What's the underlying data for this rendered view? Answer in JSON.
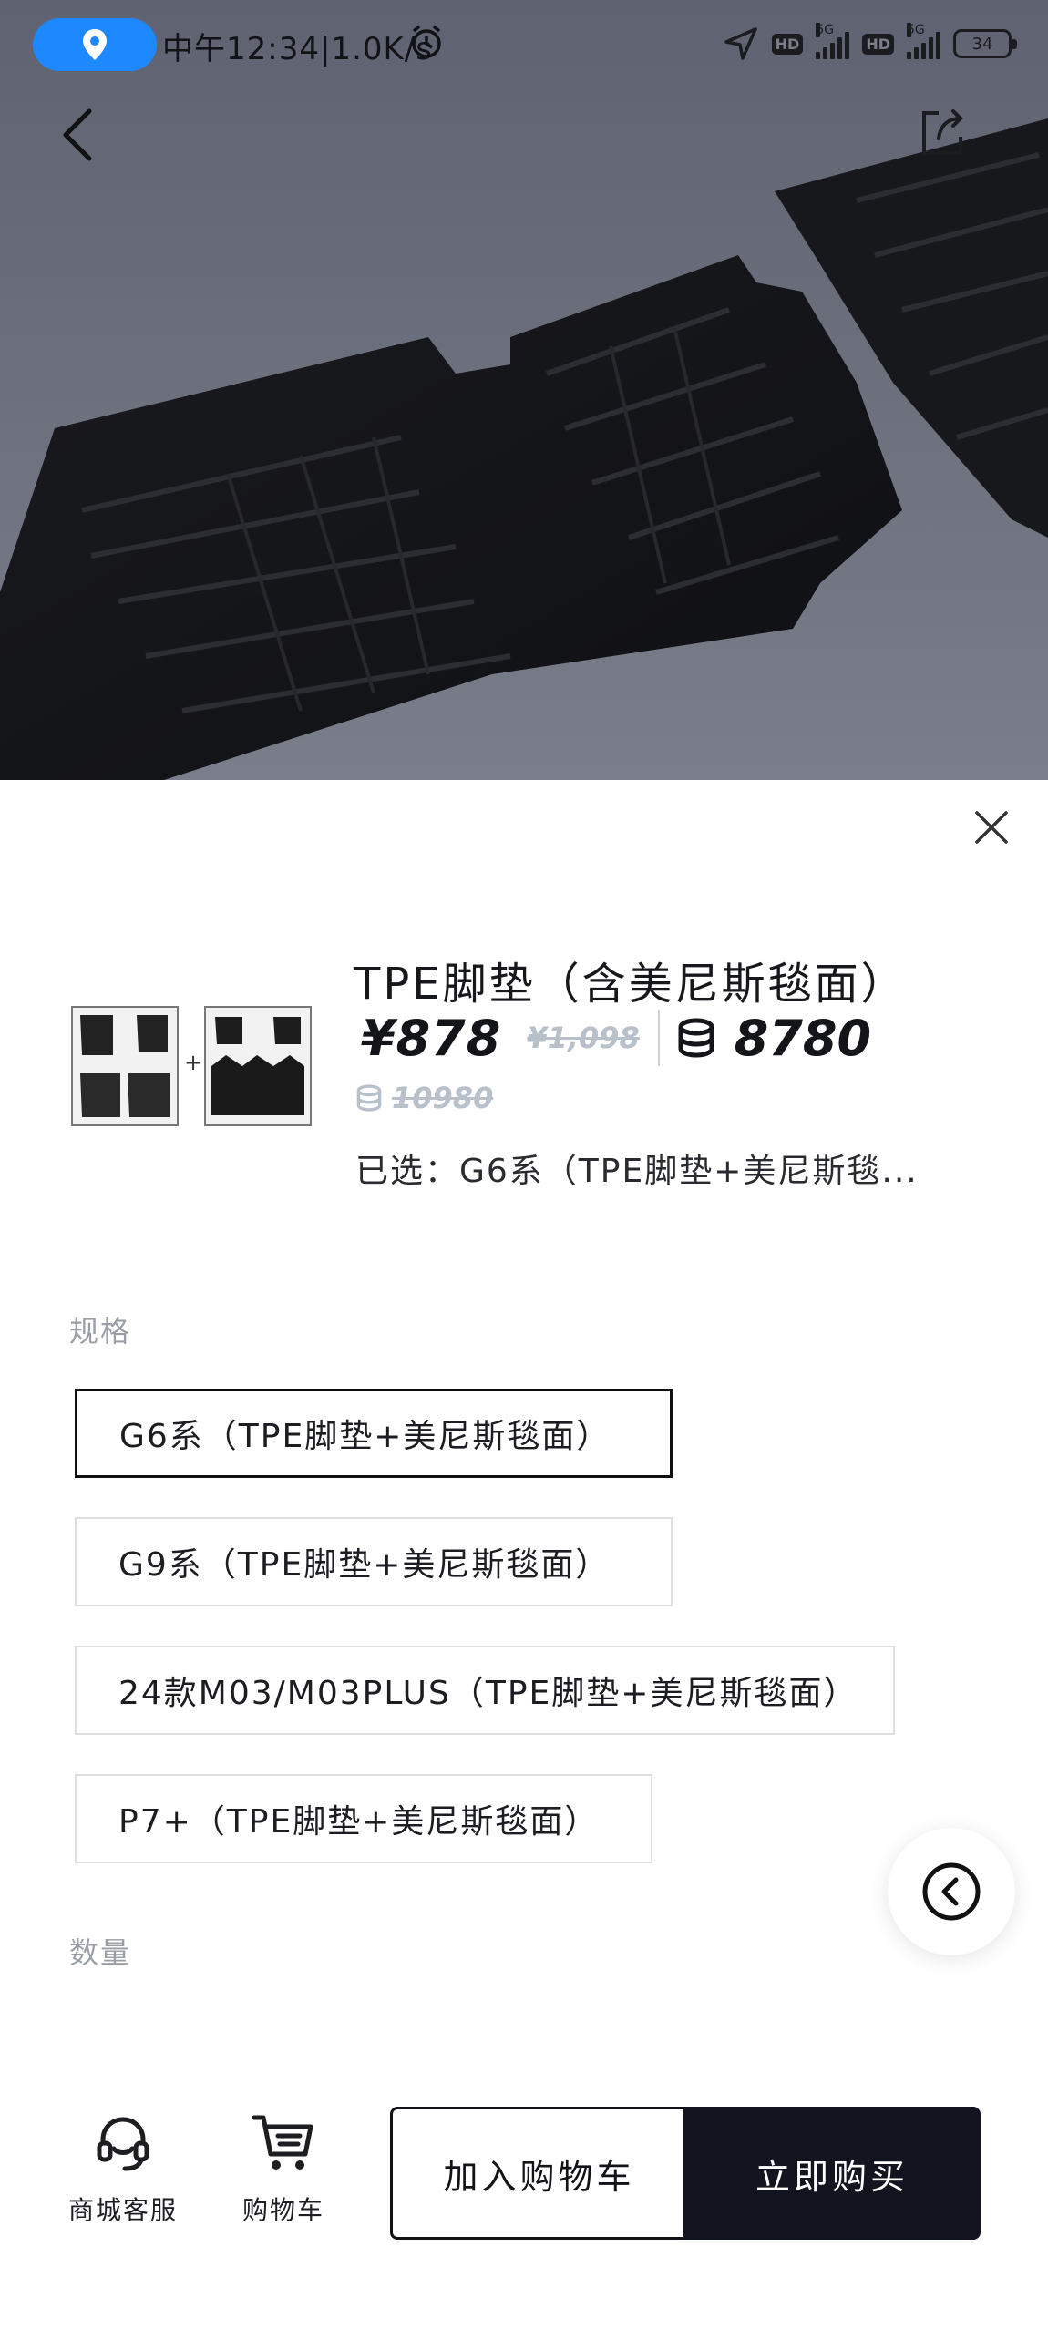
{
  "status_bar": {
    "time_text": "中午12:34|1.0K/s",
    "battery_level": "34",
    "network_badges": [
      "HD",
      "5G",
      "HD",
      "5G"
    ]
  },
  "product": {
    "title": "TPE脚垫（含美尼斯毯面）",
    "price": "¥878",
    "original_price": "¥1,098",
    "points_price": "8780",
    "original_points_price": "10980",
    "selected_text": "已选：G6系（TPE脚垫+美尼斯毯..."
  },
  "spec": {
    "label": "规格",
    "options": [
      {
        "label": "G6系（TPE脚垫+美尼斯毯面）",
        "selected": true
      },
      {
        "label": "G9系（TPE脚垫+美尼斯毯面）",
        "selected": false
      },
      {
        "label": "24款M03/M03PLUS（TPE脚垫+美尼斯毯面）",
        "selected": false
      },
      {
        "label": "P7+（TPE脚垫+美尼斯毯面）",
        "selected": false
      }
    ]
  },
  "quantity": {
    "label": "数量"
  },
  "bottom_bar": {
    "service_label": "商城客服",
    "cart_label": "购物车",
    "add_to_cart_label": "加入购物车",
    "buy_now_label": "立即购买"
  },
  "icons": {
    "location": "location-pin-icon",
    "alarm": "alarm-clock-icon",
    "navigation": "navigation-arrow-icon",
    "back": "chevron-left-icon",
    "share": "share-icon",
    "close": "close-icon",
    "coin": "coin-stack-icon",
    "float_back": "circle-chevron-left-icon",
    "service": "headset-icon",
    "cart": "shopping-cart-icon"
  },
  "colors": {
    "accent_dark": "#121420",
    "location_pill": "#1e88ff",
    "strike_grey": "#b8c0ca",
    "label_grey": "#9a9ea6"
  }
}
